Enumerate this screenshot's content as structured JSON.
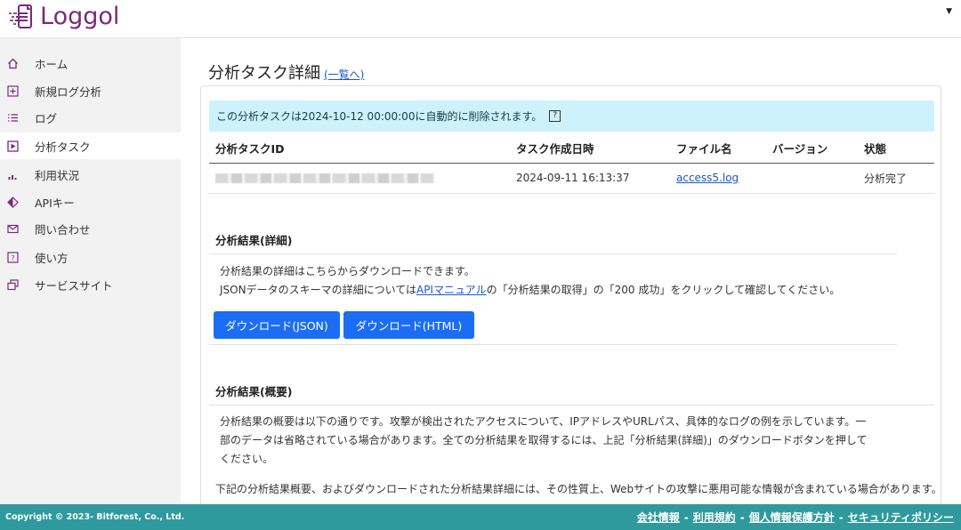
{
  "brand": {
    "name": "Loggol",
    "color": "#7a2a7c"
  },
  "sidebar": {
    "items": [
      {
        "label": "ホーム",
        "icon": "home-icon"
      },
      {
        "label": "新規ログ分析",
        "icon": "plus-square-icon"
      },
      {
        "label": "ログ",
        "icon": "list-icon"
      },
      {
        "label": "分析タスク",
        "icon": "play-square-icon",
        "active": true
      },
      {
        "label": "利用状況",
        "icon": "bar-chart-icon"
      },
      {
        "label": "APIキー",
        "icon": "api-diamond-icon"
      },
      {
        "label": "問い合わせ",
        "icon": "envelope-icon"
      },
      {
        "label": "使い方",
        "icon": "question-square-icon"
      },
      {
        "label": "サービスサイト",
        "icon": "external-windows-icon"
      }
    ]
  },
  "page": {
    "title": "分析タスク詳細",
    "back_link": "(一覧へ)"
  },
  "alert": {
    "text": "この分析タスクは2024-10-12 00:00:00に自動的に削除されます。",
    "help": "?"
  },
  "task_table": {
    "headers": [
      "分析タスクID",
      "タスク作成日時",
      "ファイル名",
      "バージョン",
      "状態"
    ],
    "row": {
      "id": "",
      "created": "2024-09-11 16:13:37",
      "file": "access5.log",
      "version": "",
      "status": "分析完了"
    }
  },
  "detail_section": {
    "title": "分析結果(詳細)",
    "line1": "分析結果の詳細はこちらからダウンロードできます。",
    "line2_prefix": "JSONデータのスキーマの詳細については",
    "line2_link": "APIマニュアル",
    "line2_suffix": "の「分析結果の取得」の「200 成功」をクリックして確認してください。",
    "button_json": "ダウンロード(JSON)",
    "button_html": "ダウンロード(HTML)"
  },
  "summary_section": {
    "title": "分析結果(概要)",
    "para_line1": "分析結果の概要は以下の通りです。攻撃が検出されたアクセスについて、IPアドレスやURLパス、具体的なログの例を示しています。一",
    "para_line2": "部のデータは省略されている場合があります。全ての分析結果を取得するには、上記「分析結果(詳細)」のダウンロードボタンを押して",
    "para_line3": "ください。",
    "warning_line1": "下記の分析結果概要、およびダウンロードされた分析結果詳細には、その性質上、Webサイトの攻撃に悪用可能な情報が含まれている場合があります。悪用"
  },
  "footer": {
    "copyright": "Copyright © 2023- Bitforest, Co., Ltd.",
    "links": [
      "会社情報",
      "利用規約",
      "個人情報保護方針",
      "セキュリティポリシー"
    ],
    "separator": "-",
    "background": "#2e9a9e"
  },
  "colors": {
    "accent": "#1b6ef3",
    "alert_bg": "#cdf2fb",
    "link": "#1a56d6"
  }
}
